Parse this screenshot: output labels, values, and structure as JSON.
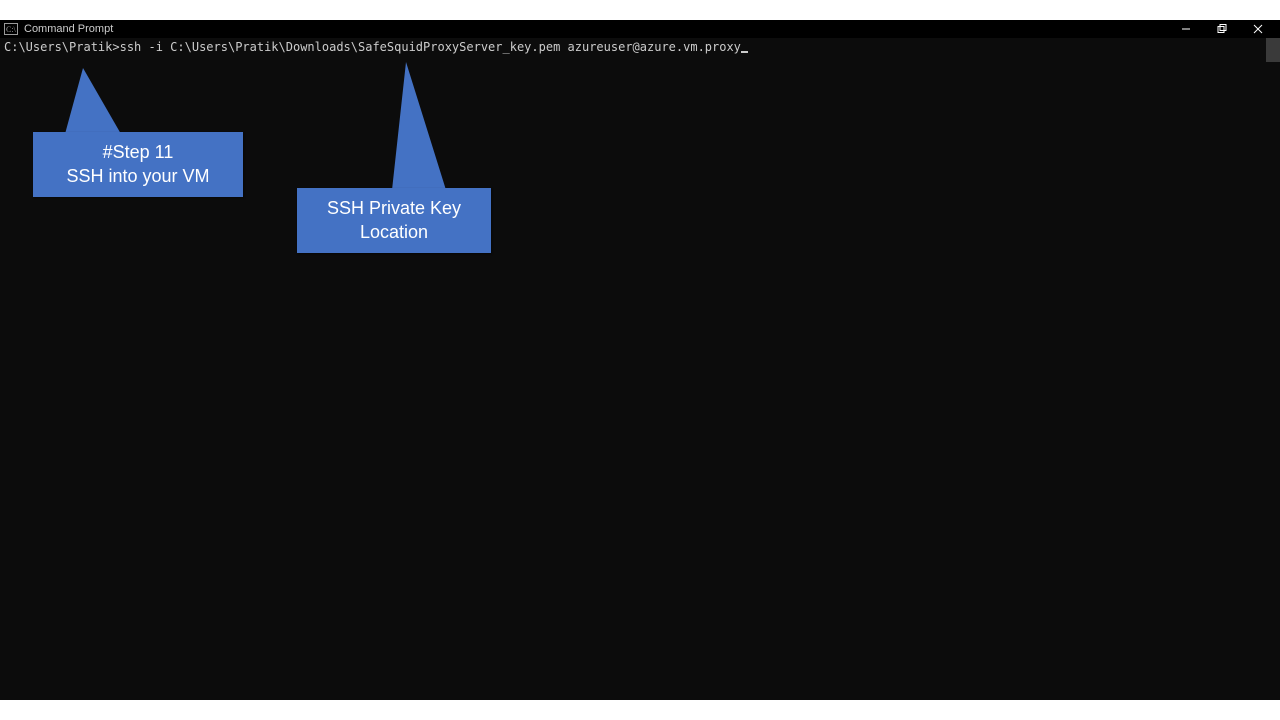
{
  "titlebar": {
    "title": "Command Prompt"
  },
  "terminal": {
    "prompt": "C:\\Users\\Pratik>",
    "command": "ssh -i C:\\Users\\Pratik\\Downloads\\SafeSquidProxyServer_key.pem azureuser@azure.vm.proxy"
  },
  "callouts": {
    "step": "#Step 11\nSSH into your VM",
    "keyloc": "SSH Private Key\nLocation"
  }
}
